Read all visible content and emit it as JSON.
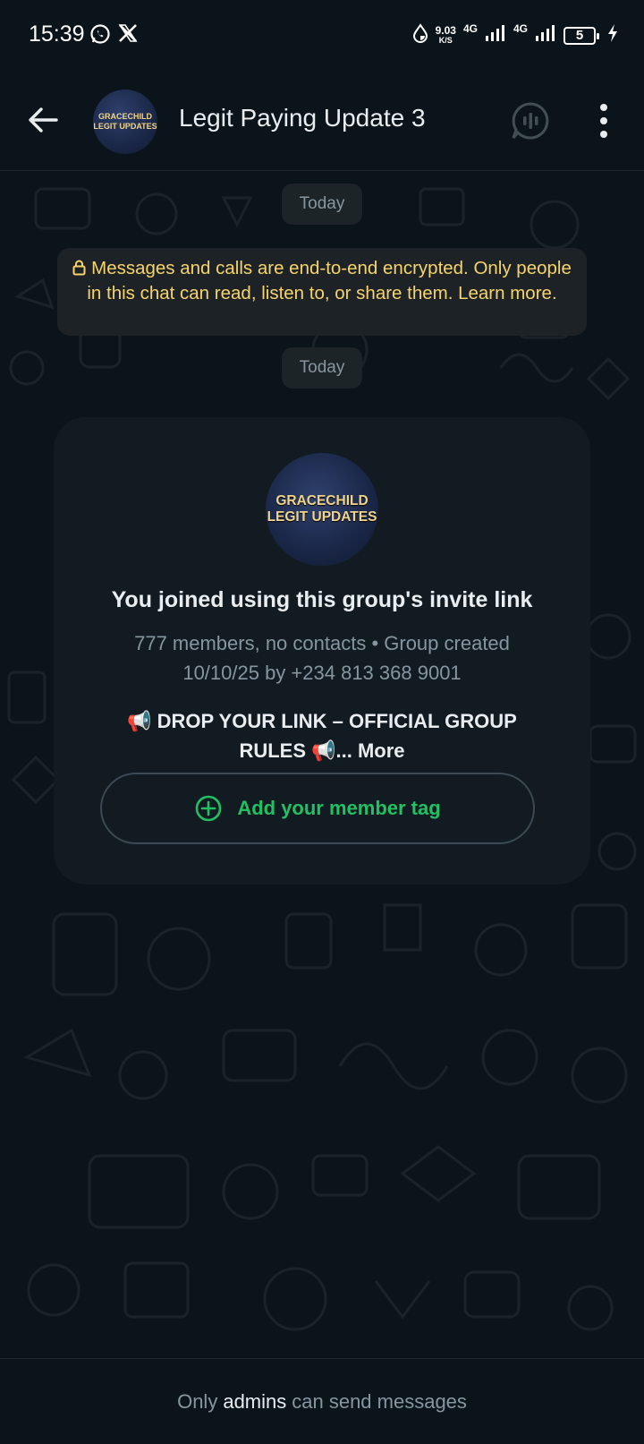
{
  "status_bar": {
    "time": "15:39",
    "net_speed_value": "9.03",
    "net_speed_unit": "K/S",
    "network_1": "4G",
    "network_2": "4G",
    "battery": "5"
  },
  "header": {
    "title": "Legit Paying Update 3",
    "avatar_line1": "GRACECHILD",
    "avatar_line2": "LEGIT UPDATES"
  },
  "chat": {
    "date_chip_1": "Today",
    "encryption_notice": "Messages and calls are end-to-end encrypted. Only people in this chat can read, listen to, or share them. Learn more.",
    "date_chip_2": "Today"
  },
  "group_card": {
    "avatar_line1": "GRACECHILD",
    "avatar_line2": "LEGIT UPDATES",
    "title": "You joined using this group's invite link",
    "subtitle": "777 members, no contacts • Group created 10/10/25 by +234 813 368 9001",
    "description": "📢 DROP YOUR LINK – OFFICIAL GROUP RULES 📢...",
    "more_label": "More",
    "member_tag_button": "Add your member tag"
  },
  "footer": {
    "prefix": "Only",
    "admins": "admins",
    "suffix": "can send messages"
  },
  "colors": {
    "background": "#0b141a",
    "accent_green": "#21c063",
    "encryption_text": "#f7d46b",
    "card_bg": "#111b21"
  },
  "icons": {
    "status_apps": [
      "whatsapp-icon",
      "x-icon"
    ],
    "status_right": [
      "data-saver-icon",
      "signal-icon",
      "battery-icon",
      "charging-icon"
    ],
    "header": [
      "back-arrow-icon",
      "voice-chat-icon",
      "more-vert-icon"
    ],
    "card": [
      "add-circle-icon"
    ],
    "notice": [
      "lock-icon"
    ]
  }
}
